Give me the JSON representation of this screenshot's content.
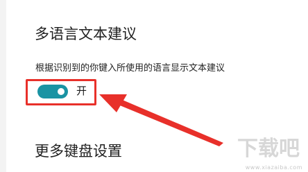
{
  "section": {
    "title": "多语言文本建议",
    "description": "根据识别到的你键入所使用的语言显示文本建议"
  },
  "toggle": {
    "state": "on",
    "label": "开",
    "accent_color": "#1a93a3"
  },
  "annotation": {
    "box_color": "#e8302a",
    "arrow_color": "#e8302a"
  },
  "more_settings": {
    "title": "更多键盘设置"
  },
  "watermark": {
    "logo_text": "下载吧",
    "url": "www.xiazaiba.com"
  }
}
